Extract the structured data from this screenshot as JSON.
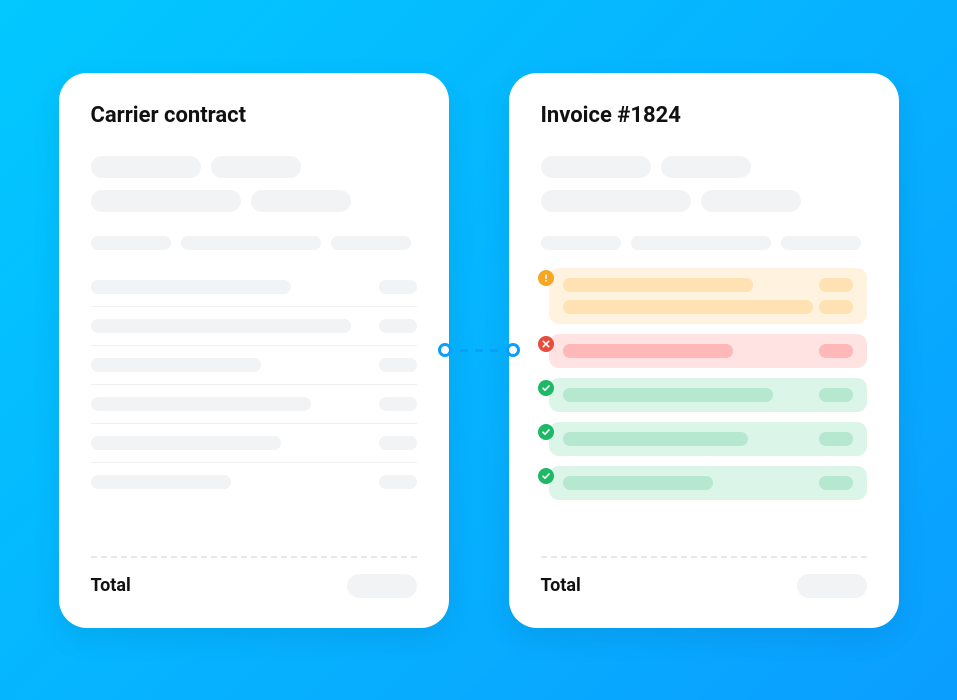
{
  "contract": {
    "title": "Carrier contract",
    "total_label": "Total"
  },
  "invoice": {
    "title": "Invoice #1824",
    "total_label": "Total",
    "comparison_status": {
      "row0": "warning",
      "row1": "error",
      "row2": "ok",
      "row3": "ok",
      "row4": "ok"
    }
  }
}
